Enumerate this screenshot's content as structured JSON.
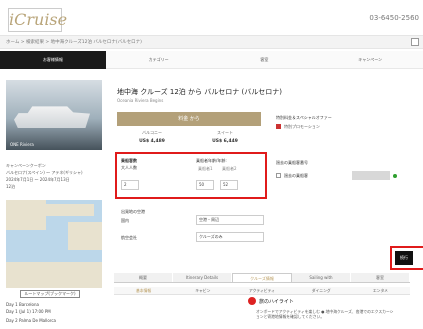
{
  "header": {
    "logo": "iCruise",
    "phone": "03-6450-2560"
  },
  "breadcrumb": "ホーム > 検索結果 > 地中海クルーズ12泊 バルセロナ(バルセロナ)",
  "steps": [
    "お客様情報",
    "カテゴリー",
    "客室",
    "キャンペーン"
  ],
  "sidebar": {
    "ship_name": "ONE Riviera",
    "info": [
      "キャンペーンクーポン",
      "バルセロナ(スペイン) ～ アテネ(ギリシャ)",
      "2024年7月1日 ～ 2024年7月13日",
      "12泊"
    ],
    "route_button": "ルートマップ(ブックマーク)",
    "days": [
      "Day 1 Barcelona",
      "Day 1 (Jul 1) 17:00 PM",
      "Day 2 Palma De Mallorca"
    ]
  },
  "main": {
    "title": "地中海 クルーズ 12泊 から バルセロナ (バルセロナ)",
    "subtitle": "Oceania Riviera Begins",
    "price_header": "料金 から",
    "price_cols": [
      {
        "label": "バルコニー",
        "value": "US$ 4,489"
      },
      {
        "label": "スイート",
        "value": "US$ 6,449"
      }
    ],
    "offer_heading": "特別料金＆スペシャルオファー",
    "offer_label": "特別プロモーション"
  },
  "form": {
    "guests_label": "乗船客数",
    "adults_label": "大人人数",
    "adults_value": "2",
    "ages_label": "乗船者年齢/年齢:",
    "age_sub1": "乗船者1",
    "age_sub2": "乗船者2",
    "age1": "50",
    "age2": "52",
    "past_label": "過去の乗船客番号",
    "past_check": "過去の乗船客",
    "depart_label": "出発地の空港",
    "depart_value": "国内",
    "depart_sub": "空港・周辺",
    "depart_select": "空港・周辺",
    "airline_label": "航空会社",
    "airline_select": "クルーズのみ"
  },
  "next_button": "続行",
  "tabs": [
    "概要",
    "Itinerary Details",
    "クルーズ情報",
    "Sailing with",
    "客室"
  ],
  "active_tab": 2,
  "subtabs": [
    "基本情報",
    "キャビン",
    "アクティビティ",
    "ダイニング",
    "エンタメ"
  ],
  "highlight": {
    "title": "旅のハイライト",
    "text": "オンボードでアクティビティを楽しむ ● 地中海クルーズ、各港でのエクスカーションと寄港地情報を確認してください。"
  },
  "colors": {
    "accent": "#b3a079",
    "highlight_red": "#e01b1b",
    "step_active": "#1a1a1a"
  }
}
